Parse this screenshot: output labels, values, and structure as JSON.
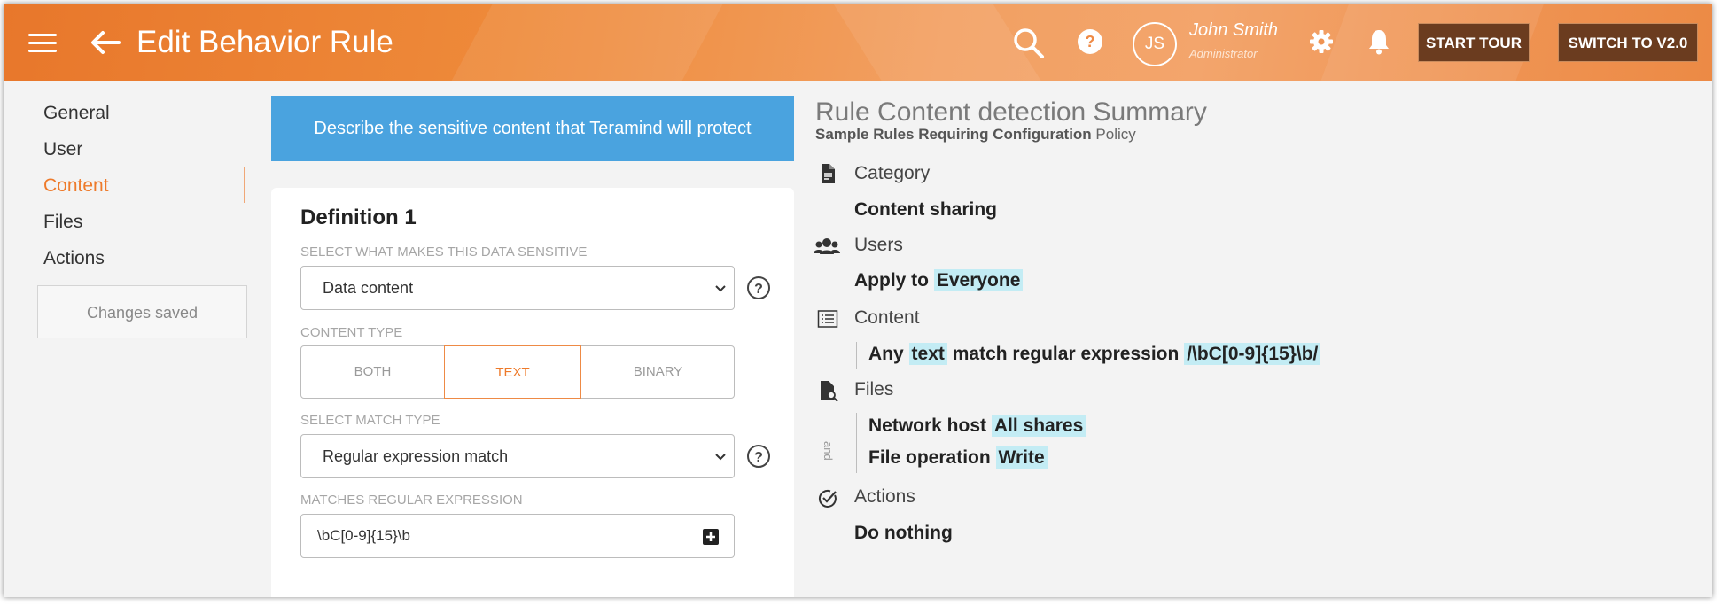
{
  "header": {
    "title": "Edit Behavior Rule",
    "user": {
      "initials": "JS",
      "name": "John Smith",
      "role": "Administrator"
    },
    "buttons": {
      "start_tour": "START TOUR",
      "switch_version": "SWITCH TO V2.0"
    },
    "icons": [
      "menu-icon",
      "back-arrow-icon",
      "search-icon",
      "help-icon",
      "gear-icon",
      "bell-icon"
    ]
  },
  "sidebar": {
    "items": [
      {
        "label": "General",
        "active": false
      },
      {
        "label": "User",
        "active": false
      },
      {
        "label": "Content",
        "active": true
      },
      {
        "label": "Files",
        "active": false
      },
      {
        "label": "Actions",
        "active": false
      }
    ],
    "status": "Changes saved"
  },
  "content": {
    "banner": "Describe the sensitive content that Teramind will protect",
    "definition_title": "Definition 1",
    "sensitive_label": "SELECT WHAT MAKES THIS DATA SENSITIVE",
    "sensitive_value": "Data content",
    "content_type_label": "CONTENT TYPE",
    "content_type_options": [
      "BOTH",
      "TEXT",
      "BINARY"
    ],
    "content_type_selected": "TEXT",
    "match_type_label": "SELECT MATCH TYPE",
    "match_type_value": "Regular expression match",
    "regex_label": "MATCHES REGULAR EXPRESSION",
    "regex_value": "\\bC[0-9]{15}\\b"
  },
  "summary": {
    "title": "Rule Content detection Summary",
    "policy_name": "Sample Rules Requiring Configuration",
    "policy_suffix": "Policy",
    "category": {
      "head": "Category",
      "value": "Content sharing"
    },
    "users": {
      "head": "Users",
      "prefix": "Apply to",
      "value": "Everyone"
    },
    "content": {
      "head": "Content",
      "w1": "Any",
      "type": "text",
      "w2": "match regular expression",
      "regex": "/\\bC[0-9]{15}\\b/"
    },
    "files": {
      "head": "Files",
      "and_label": "and",
      "row1_prefix": "Network host",
      "row1_value": "All shares",
      "row2_prefix": "File operation",
      "row2_value": "Write"
    },
    "actions": {
      "head": "Actions",
      "value": "Do nothing"
    }
  },
  "colors": {
    "accent": "#ee7a2a",
    "banner": "#4aa3df",
    "highlight": "#c3ecf4",
    "header_button": "#6b3c1f"
  }
}
